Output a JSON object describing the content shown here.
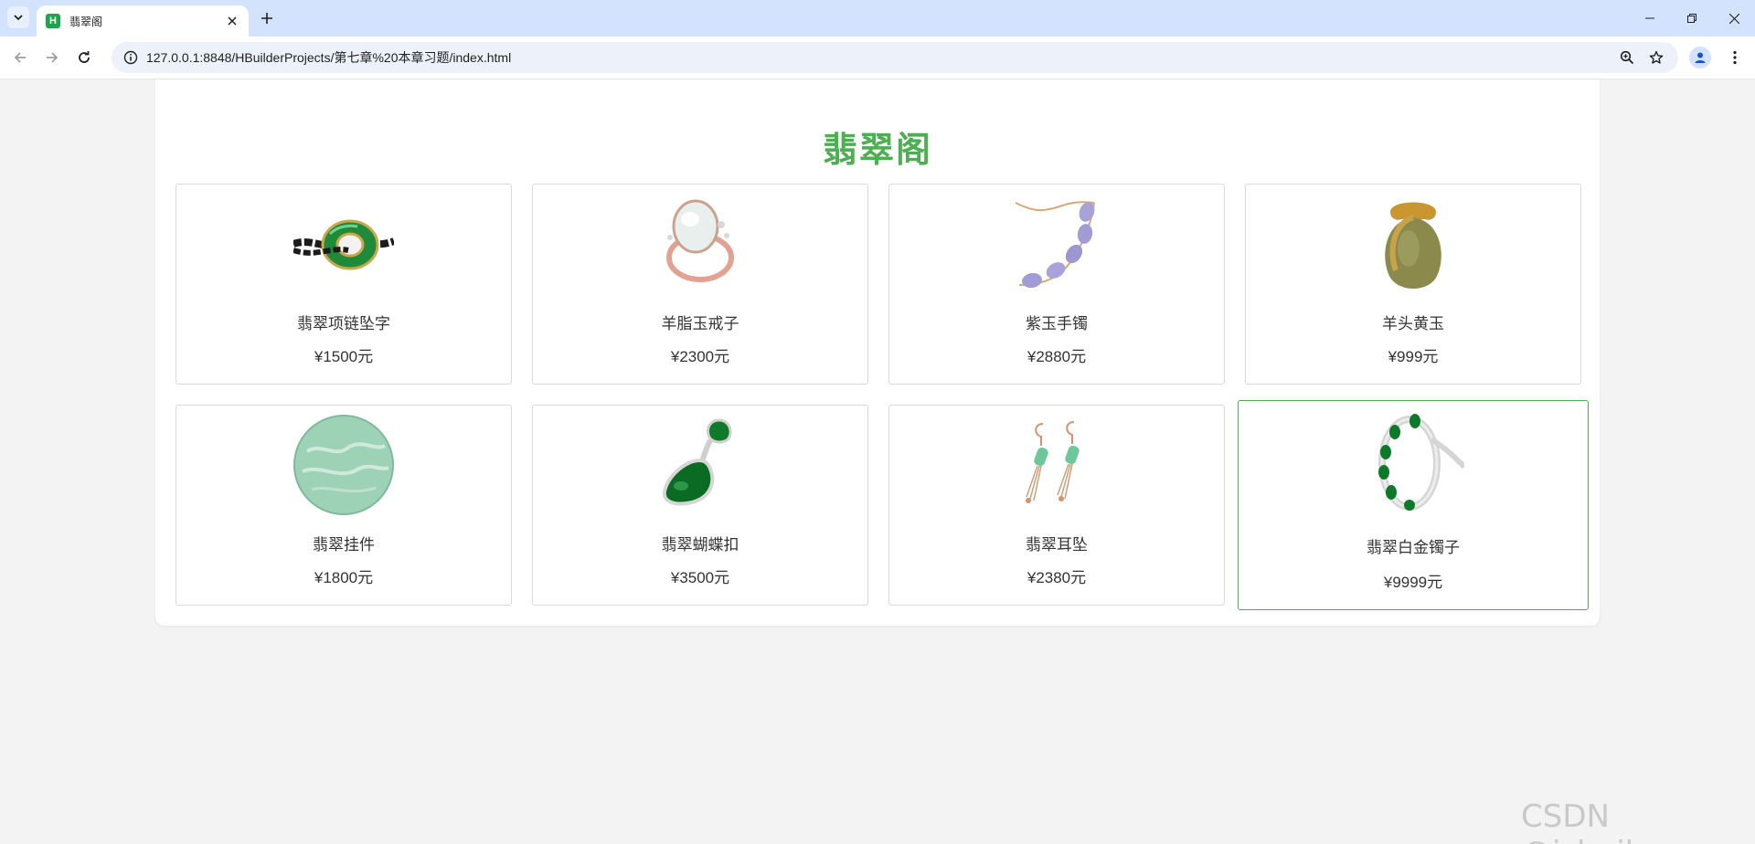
{
  "browser": {
    "tab_title": "翡翠阁",
    "favicon_letter": "H",
    "url": "127.0.0.1:8848/HBuilderProjects/第七章%20本章习题/index.html"
  },
  "page": {
    "title": "翡翠阁",
    "accent_color": "#4caf50",
    "products": [
      {
        "name": "翡翠项链坠字",
        "price": "¥1500元",
        "icon": "jade-ring-pendant-icon"
      },
      {
        "name": "羊脂玉戒子",
        "price": "¥2300元",
        "icon": "mutton-fat-jade-ring-icon"
      },
      {
        "name": "紫玉手镯",
        "price": "¥2880元",
        "icon": "purple-jade-bracelet-icon"
      },
      {
        "name": "羊头黄玉",
        "price": "¥999元",
        "icon": "yellow-jade-pendant-icon"
      },
      {
        "name": "翡翠挂件",
        "price": "¥1800元",
        "icon": "jade-disc-pendant-icon"
      },
      {
        "name": "翡翠蝴蝶扣",
        "price": "¥3500元",
        "icon": "jade-butterfly-pendant-icon"
      },
      {
        "name": "翡翠耳坠",
        "price": "¥2380元",
        "icon": "jade-earrings-icon"
      },
      {
        "name": "翡翠白金镯子",
        "price": "¥9999元",
        "icon": "jade-platinum-bangle-icon"
      }
    ]
  },
  "watermark": "CSDN @isbgjbs"
}
